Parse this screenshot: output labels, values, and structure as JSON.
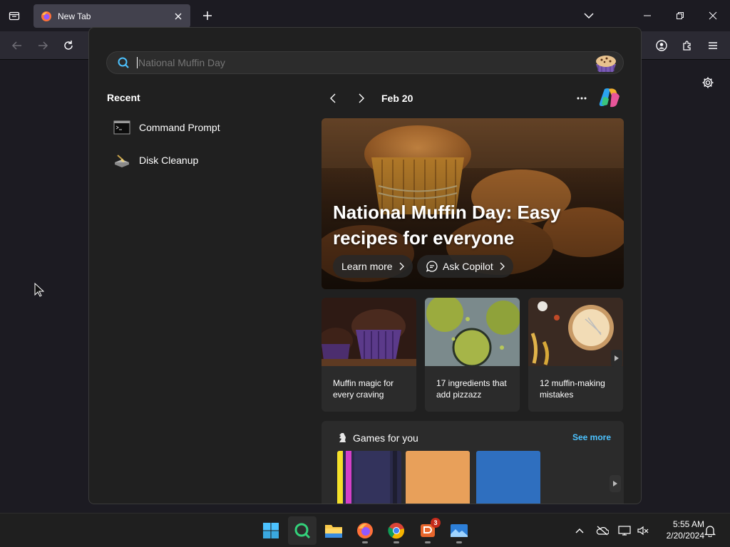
{
  "browser": {
    "tab": {
      "title": "New Tab",
      "favicon": "firefox-icon"
    },
    "new_tab_icon": "plus-icon",
    "window_controls": [
      "chevron-down-icon",
      "minimize-icon",
      "restore-icon",
      "close-icon"
    ],
    "toolbar_icons": [
      "back-arrow-icon",
      "forward-arrow-icon",
      "reload-icon",
      "account-icon",
      "extensions-icon",
      "menu-icon"
    ],
    "page_settings_icon": "gear-icon"
  },
  "flyout": {
    "search": {
      "value": "National Muffin Day",
      "icon": "search-icon",
      "badge_icon": "muffin-icon"
    },
    "recent": {
      "heading": "Recent",
      "items": [
        {
          "label": "Command Prompt",
          "icon": "command-prompt-icon"
        },
        {
          "label": "Disk Cleanup",
          "icon": "disk-cleanup-icon"
        }
      ]
    },
    "date_nav": {
      "date": "Feb 20",
      "prev_icon": "chevron-left-icon",
      "next_icon": "chevron-right-icon",
      "more_icon": "ellipsis-icon",
      "copilot_icon": "copilot-icon"
    },
    "hero": {
      "title": "National Muffin Day: Easy recipes for everyone",
      "learn_more": "Learn more",
      "ask_copilot": "Ask Copilot"
    },
    "cards": [
      {
        "title": "Muffin magic for every craving"
      },
      {
        "title": "17 ingredients that add pizzazz"
      },
      {
        "title": "12 muffin-making mistakes"
      }
    ],
    "games": {
      "title": "Games for you",
      "see_more": "See more",
      "icon": "chess-knight-icon"
    }
  },
  "taskbar": {
    "apps": [
      "windows-start-icon",
      "search-app-icon",
      "file-explorer-icon",
      "firefox-icon",
      "chrome-icon",
      "office-app-icon",
      "photos-app-icon"
    ],
    "notification_badge": "3",
    "tray": [
      "chevron-up-icon",
      "onedrive-icon",
      "display-icon",
      "volume-muted-icon",
      "bell-icon"
    ],
    "time": "5:55 AM",
    "date": "2/20/2024"
  },
  "colors": {
    "accent": "#4cc2ff",
    "flyout_bg": "#202020",
    "card_bg": "#2b2b2b",
    "browser_bg": "#1c1b22"
  }
}
